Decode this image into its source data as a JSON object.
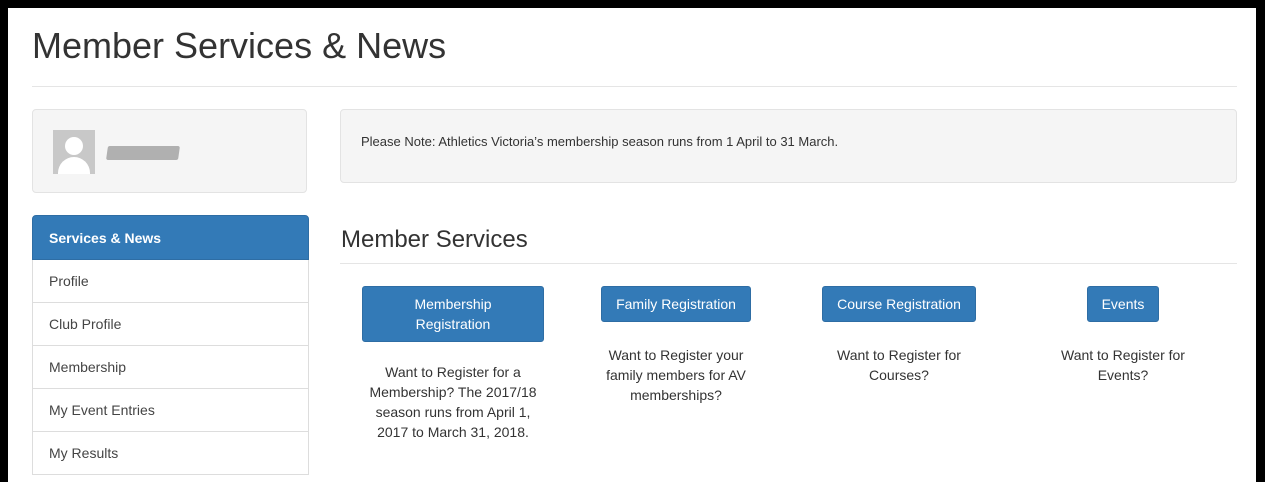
{
  "page": {
    "title": "Member Services & News"
  },
  "notice": {
    "text": "Please Note: Athletics Victoria’s membership season runs from 1 April to 31 March."
  },
  "sidebar": {
    "items": [
      {
        "label": "Services & News",
        "active": true
      },
      {
        "label": "Profile"
      },
      {
        "label": "Club Profile"
      },
      {
        "label": "Membership"
      },
      {
        "label": "My Event Entries"
      },
      {
        "label": "My Results"
      }
    ]
  },
  "services": {
    "title": "Member Services",
    "cards": [
      {
        "button": "Membership Registration",
        "desc": "Want to Register for a Membership? The 2017/18 season runs from April 1, 2017 to March 31, 2018."
      },
      {
        "button": "Family Registration",
        "desc": "Want to Register your family members for AV memberships?"
      },
      {
        "button": "Course Registration",
        "desc": "Want to Register for Courses?"
      },
      {
        "button": "Events",
        "desc": "Want to Register for Events?"
      }
    ]
  },
  "colors": {
    "primary": "#337ab7",
    "panel": "#f5f5f5"
  }
}
